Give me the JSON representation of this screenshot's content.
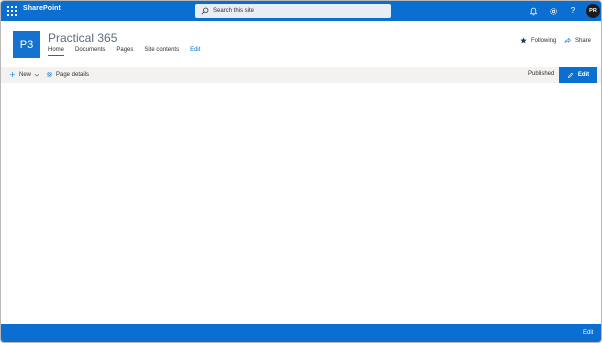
{
  "suite_bar": {
    "brand": "SharePoint",
    "search_placeholder": "Search this site",
    "avatar_initials": "PR",
    "color": "#0a6fd0"
  },
  "site_header": {
    "logo_text": "P3",
    "title": "Practical 365",
    "nav": [
      {
        "label": "Home",
        "active": true
      },
      {
        "label": "Documents"
      },
      {
        "label": "Pages"
      },
      {
        "label": "Site contents"
      },
      {
        "label": "Edit"
      }
    ],
    "following_label": "Following",
    "share_label": "Share"
  },
  "command_bar": {
    "new_label": "New",
    "page_details_label": "Page details",
    "status": "Published",
    "edit_label": "Edit"
  },
  "bottom_bar": {
    "edit_label": "Edit"
  },
  "icons": {
    "waffle": "app-launcher-icon",
    "search": "search-icon",
    "bell": "bell-icon",
    "gear": "gear-icon",
    "help": "help-icon",
    "star": "star-icon",
    "share": "share-icon",
    "plus": "plus-icon",
    "chevron": "chevron-down-icon",
    "gear_small": "gear-icon",
    "pencil": "pencil-icon"
  }
}
